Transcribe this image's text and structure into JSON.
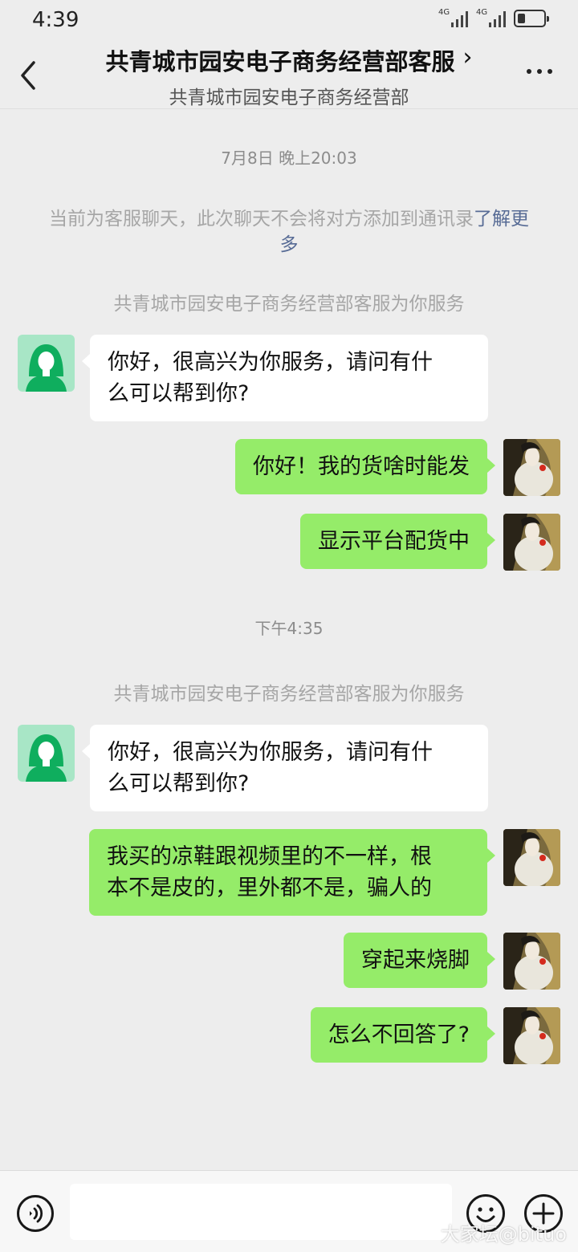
{
  "status_bar": {
    "time": "4:39",
    "signal_1_label": "4G",
    "signal_2_label": "4G"
  },
  "nav": {
    "title": "共青城市园安电子商务经营部客服",
    "subtitle": "共青城市园安电子商务经营部"
  },
  "chat": {
    "time_1": "7月8日 晚上20:03",
    "notice_text": "当前为客服聊天，此次聊天不会将对方添加到通讯录",
    "notice_link": "了解更多",
    "service_label_1": "共青城市园安电子商务经营部客服为你服务",
    "msg_1_line1": "你好，很高兴为你服务，请问有什",
    "msg_1_line2": "么可以帮到你?",
    "msg_2": "你好！我的货啥时能发",
    "msg_3": "显示平台配货中",
    "time_2": "下午4:35",
    "service_label_2": "共青城市园安电子商务经营部客服为你服务",
    "msg_4_line1": "你好，很高兴为你服务，请问有什",
    "msg_4_line2": "么可以帮到你?",
    "msg_5_line1": "我买的凉鞋跟视频里的不一样，根",
    "msg_5_line2": "本不是皮的，里外都不是，骗人的",
    "msg_6": "穿起来烧脚",
    "msg_7": "怎么不回答了?"
  },
  "input_bar": {
    "placeholder": ""
  },
  "watermark": "大家坛@bituo",
  "colors": {
    "outgoing_bubble": "#95ec69",
    "incoming_bubble": "#ffffff",
    "background": "#ededed",
    "link": "#576b95",
    "service_avatar": "#a8e6c6"
  }
}
